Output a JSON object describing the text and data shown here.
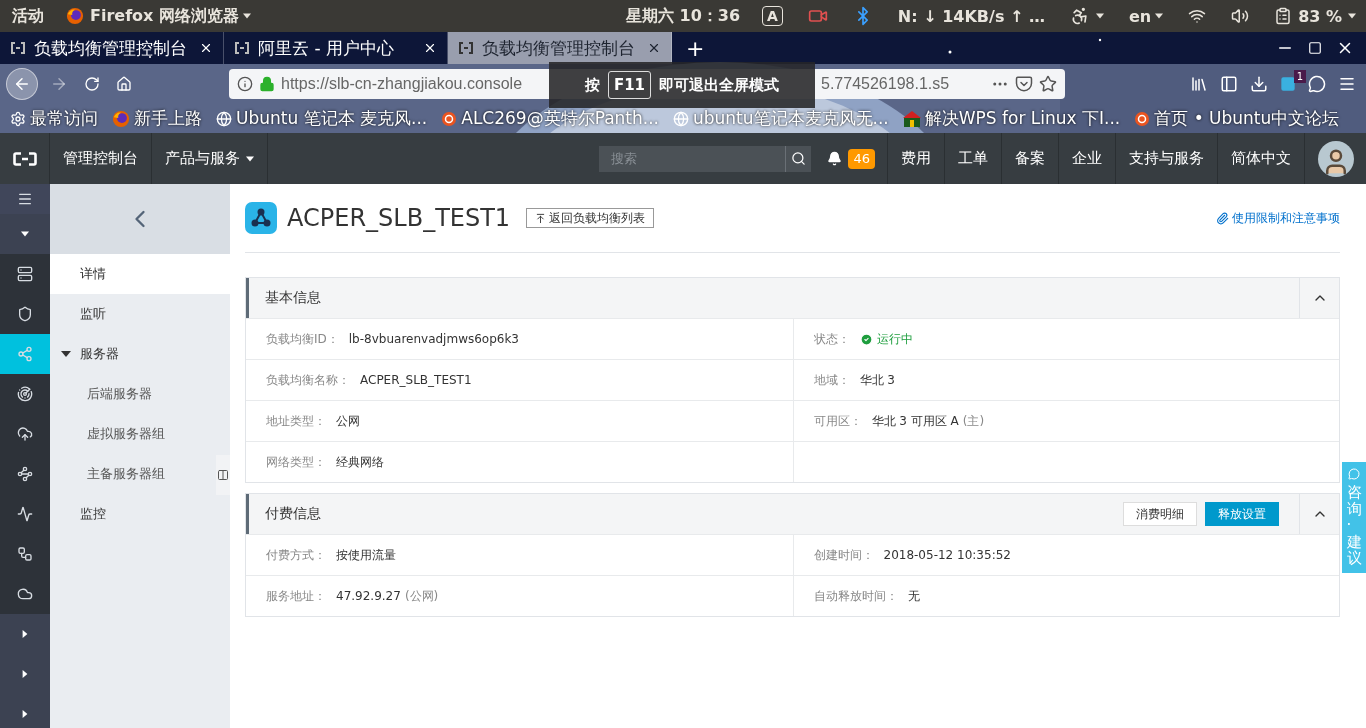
{
  "system_bar": {
    "activities": "活动",
    "app_menu": "Firefox 网络浏览器",
    "clock": "星期六 10：36",
    "input_badge": "A",
    "network_speed": "N: ↓ 14KB/s ↑ …",
    "language": "en",
    "battery": "83 %"
  },
  "browser": {
    "tabs": [
      {
        "title": "负载均衡管理控制台",
        "selected": false
      },
      {
        "title": "阿里云 - 用户中心",
        "selected": false
      },
      {
        "title": "负载均衡管理控制台",
        "selected": true
      }
    ],
    "new_tab": "+",
    "url_start": "https://slb-cn-zhangjiakou.console",
    "url_end": "5.774526198.1.s5",
    "extension_badge": "1",
    "bookmarks": [
      {
        "label": "最常访问",
        "kind": "gear"
      },
      {
        "label": "新手上路",
        "kind": "firefox"
      },
      {
        "label": "Ubuntu 笔记本 麦克风...",
        "kind": "globe"
      },
      {
        "label": "ALC269@英特尔Panth...",
        "kind": "ubuntu"
      },
      {
        "label": "ubuntu笔记本麦克风无...",
        "kind": "globe"
      },
      {
        "label": "解决WPS for Linux 下I...",
        "kind": "wps"
      },
      {
        "label": "首页 • Ubuntu中文论坛",
        "kind": "ubuntu"
      }
    ],
    "fullscreen_notice": {
      "prefix": "按",
      "key": "F11",
      "suffix": "即可退出全屏模式"
    }
  },
  "console": {
    "nav_left": [
      {
        "label": "管理控制台",
        "kind": "link"
      },
      {
        "label": "产品与服务",
        "kind": "dropdown"
      }
    ],
    "search": {
      "placeholder": "搜索"
    },
    "notification_count": "46",
    "nav_right": [
      "费用",
      "工单",
      "备案",
      "企业",
      "支持与服务",
      "简体中文"
    ]
  },
  "rail": [
    {
      "kind": "menu",
      "selected": false
    },
    {
      "kind": "caret-down",
      "selected": false
    },
    {
      "kind": "server",
      "selected": false
    },
    {
      "kind": "shield",
      "selected": false
    },
    {
      "kind": "network",
      "selected": true
    },
    {
      "kind": "radar",
      "selected": false
    },
    {
      "kind": "cloud-upload",
      "selected": false
    },
    {
      "kind": "route",
      "selected": false
    },
    {
      "kind": "wave",
      "selected": false
    },
    {
      "kind": "nodes",
      "selected": false
    },
    {
      "kind": "cloud",
      "selected": false
    },
    {
      "kind": "caret-right",
      "selected": false
    },
    {
      "kind": "caret-right",
      "selected": false
    },
    {
      "kind": "caret-right",
      "selected": false
    }
  ],
  "submenu": {
    "items": [
      {
        "label": "详情",
        "selected": true
      },
      {
        "label": "监听",
        "selected": false
      },
      {
        "label": "服务器",
        "selected": false,
        "expanded": true,
        "children": [
          {
            "label": "后端服务器",
            "selected": false
          },
          {
            "label": "虚拟服务器组",
            "selected": false
          },
          {
            "label": "主备服务器组",
            "selected": false
          }
        ]
      },
      {
        "label": "监控",
        "selected": false
      }
    ]
  },
  "page": {
    "title": "ACPER_SLB_TEST1",
    "back_button": "返回负载均衡列表",
    "help_link": "使用限制和注意事项",
    "sections": [
      {
        "title": "基本信息",
        "expanded": true,
        "rows": [
          {
            "cells": [
              {
                "label": "负载均衡ID：",
                "value": "lb-8vbuarenvadjmws6op6k3",
                "kind": "text"
              },
              {
                "label": "状态：",
                "value": "运行中",
                "kind": "status"
              }
            ]
          },
          {
            "cells": [
              {
                "label": "负载均衡名称：",
                "value": "ACPER_SLB_TEST1",
                "kind": "text"
              },
              {
                "label": "地域：",
                "value": "华北 3",
                "kind": "text"
              }
            ]
          },
          {
            "cells": [
              {
                "label": "地址类型：",
                "value": "公网",
                "kind": "text"
              },
              {
                "label": "可用区：",
                "value": "华北 3 可用区 A",
                "note": "(主)",
                "kind": "text"
              }
            ]
          },
          {
            "cells": [
              {
                "label": "网络类型：",
                "value": "经典网络",
                "kind": "text"
              }
            ]
          }
        ]
      },
      {
        "title": "付费信息",
        "expanded": true,
        "actions": [
          {
            "label": "消费明细",
            "kind": "secondary"
          },
          {
            "label": "释放设置",
            "kind": "primary"
          }
        ],
        "rows": [
          {
            "cells": [
              {
                "label": "付费方式：",
                "value": "按使用流量",
                "kind": "text"
              },
              {
                "label": "创建时间：",
                "value": "2018-05-12 10:35:52",
                "kind": "text"
              }
            ]
          },
          {
            "cells": [
              {
                "label": "服务地址：",
                "value": "47.92.9.27",
                "note": "(公网)",
                "kind": "text"
              },
              {
                "label": "自动释放时间：",
                "value": "无",
                "kind": "text"
              }
            ]
          }
        ]
      }
    ]
  },
  "feedback_tab": "咨询·建议"
}
